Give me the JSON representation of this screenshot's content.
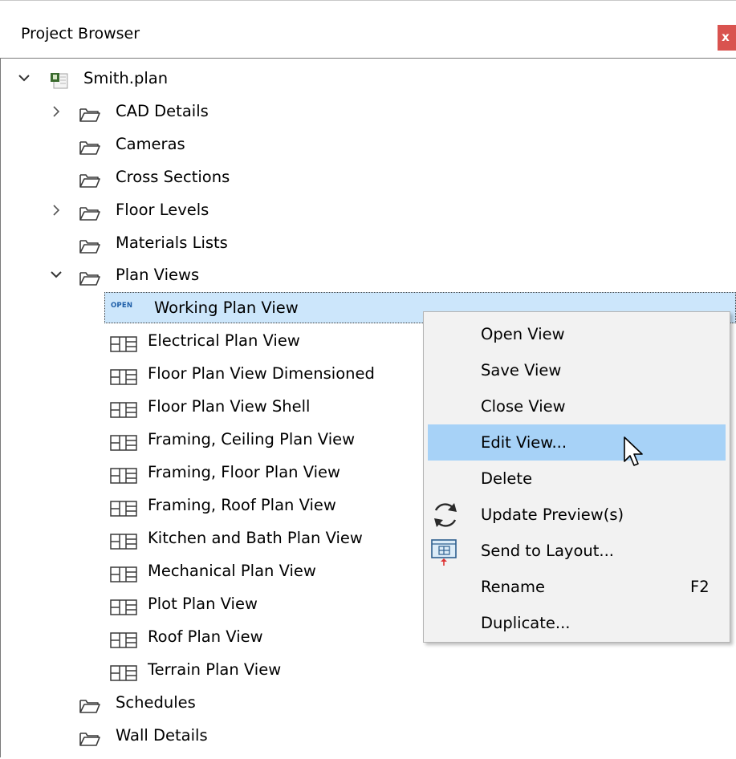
{
  "panel": {
    "title": "Project Browser",
    "close_label": "x"
  },
  "tree": {
    "root": {
      "label": "Smith.plan"
    },
    "folders": {
      "cad_details": "CAD Details",
      "cameras": "Cameras",
      "cross_sections": "Cross Sections",
      "floor_levels": "Floor Levels",
      "materials_lists": "Materials Lists",
      "plan_views": "Plan Views",
      "schedules": "Schedules",
      "wall_details": "Wall Details"
    },
    "open_tag": "OPEN",
    "plan_views": [
      "Working Plan View",
      "Electrical Plan View",
      "Floor Plan View Dimensioned",
      "Floor Plan View Shell",
      "Framing, Ceiling Plan View",
      "Framing, Floor Plan View",
      "Framing, Roof Plan View",
      "Kitchen and Bath Plan View",
      "Mechanical Plan View",
      "Plot Plan View",
      "Roof Plan View",
      "Terrain Plan View"
    ]
  },
  "context_menu": {
    "items": [
      {
        "label": "Open View"
      },
      {
        "label": "Save View"
      },
      {
        "label": "Close View"
      },
      {
        "label": "Edit View..."
      },
      {
        "label": "Delete"
      },
      {
        "label": "Update Preview(s)",
        "icon": "refresh-icon"
      },
      {
        "label": "Send to Layout...",
        "icon": "send-to-layout-icon"
      },
      {
        "label": "Rename",
        "shortcut": "F2"
      },
      {
        "label": "Duplicate..."
      }
    ],
    "highlight_color": "#a7d2f7"
  },
  "colors": {
    "selection": "#cce6fb",
    "close_button": "#d9534f",
    "open_tag": "#1f5fa8"
  }
}
